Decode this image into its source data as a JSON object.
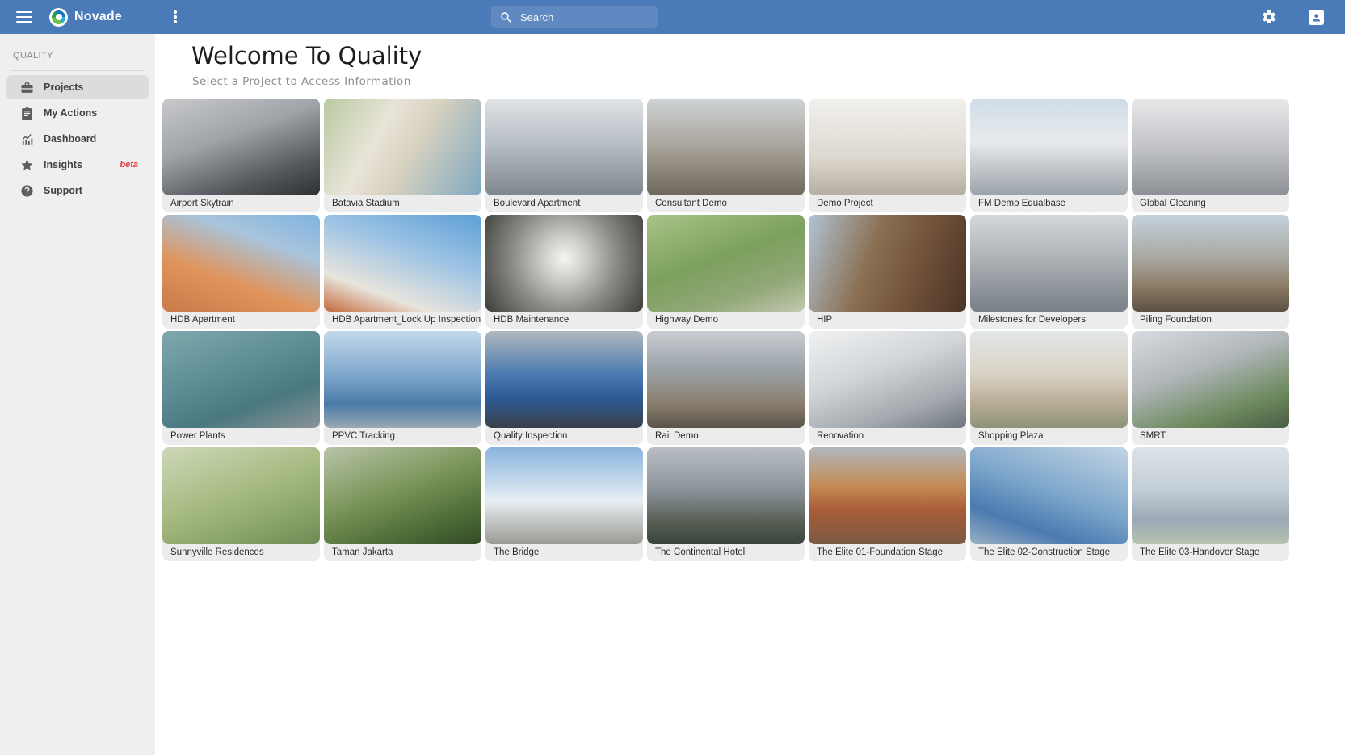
{
  "header": {
    "app_name": "Novade",
    "search_placeholder": "Search"
  },
  "sidebar": {
    "section_label": "QUALITY",
    "items": [
      {
        "label": "Projects",
        "icon": "briefcase",
        "active": true
      },
      {
        "label": "My Actions",
        "icon": "clipboard",
        "active": false
      },
      {
        "label": "Dashboard",
        "icon": "chart",
        "active": false
      },
      {
        "label": "Insights",
        "icon": "star",
        "active": false,
        "badge": "beta"
      },
      {
        "label": "Support",
        "icon": "help",
        "active": false
      }
    ]
  },
  "main": {
    "title": "Welcome To Quality",
    "subtitle": "Select a Project to Access Information",
    "projects": [
      {
        "name": "Airport Skytrain",
        "thumb": "linear-gradient(160deg,#c8c9cb 0%,#9fa3a8 40%,#55585c 75%,#2e3134 100%)"
      },
      {
        "name": "Batavia Stadium",
        "thumb": "linear-gradient(120deg,#b8c9a0 0%,#e8e4d8 35%,#d8d2c0 55%,#7fa8c0 100%)"
      },
      {
        "name": "Boulevard Apartment",
        "thumb": "linear-gradient(180deg,#dfe3e6 0%,#b9c0c6 45%,#7d858d 100%)"
      },
      {
        "name": "Consultant Demo",
        "thumb": "linear-gradient(180deg,#cfd3d6 0%,#a8a39a 50%,#6e675e 100%)"
      },
      {
        "name": "Demo Project",
        "thumb": "linear-gradient(180deg,#f2f1ee 0%,#ddd8d0 60%,#b5ad9f 100%)"
      },
      {
        "name": "FM Demo Equalbase",
        "thumb": "linear-gradient(180deg,#cfdce8 0%,#e8eaec 45%,#9aa2a8 100%)"
      },
      {
        "name": "Global Cleaning",
        "thumb": "linear-gradient(180deg,#e8e8ea 0%,#c2c4c8 50%,#8d9094 100%)"
      },
      {
        "name": "HDB Apartment",
        "thumb": "linear-gradient(200deg,#7fb3e0 0%,#a8c4dc 30%,#e0945c 65%,#c97a48 100%)"
      },
      {
        "name": "HDB Apartment_Lock Up Inspection",
        "thumb": "linear-gradient(200deg,#5d9fd6 0%,#9ec4e4 40%,#e8e4dc 75%,#c46a3c 100%)"
      },
      {
        "name": "HDB Maintenance",
        "thumb": "radial-gradient(circle at 50% 45%,#f5f5f2 0%,#c9c9c4 25%,#8a8a86 55%,#3c3c3a 100%)"
      },
      {
        "name": "Highway Demo",
        "thumb": "linear-gradient(160deg,#a8c488 0%,#7ba05e 45%,#93a878 75%,#c2c8b0 100%)"
      },
      {
        "name": "HIP",
        "thumb": "linear-gradient(110deg,#b0c4d4 0%,#8a6f52 40%,#6e4f38 70%,#4a3426 100%)"
      },
      {
        "name": "Milestones for Developers",
        "thumb": "linear-gradient(180deg,#d4d8da 0%,#a8aeb2 50%,#787f85 100%)"
      },
      {
        "name": "Piling Foundation",
        "thumb": "linear-gradient(180deg,#c4d2dc 0%,#a8a8a0 45%,#8a7a64 75%,#5c5044 100%)"
      },
      {
        "name": "Power Plants",
        "thumb": "linear-gradient(160deg,#7fa8ad 0%,#5f8e96 40%,#4a7880 70%,#8a9498 100%)"
      },
      {
        "name": "PPVC Tracking",
        "thumb": "linear-gradient(180deg,#c2d8ea 0%,#7fa8cc 45%,#4a7aa8 75%,#9aa8b4 100%)"
      },
      {
        "name": "Quality Inspection",
        "thumb": "linear-gradient(180deg,#b0b8bd 0%,#4a7ab0 45%,#2c5a94 70%,#3a4048 100%)"
      },
      {
        "name": "Rail Demo",
        "thumb": "linear-gradient(180deg,#c8ccd0 0%,#9aa2a8 40%,#8a7f6e 75%,#5a5248 100%)"
      },
      {
        "name": "Renovation",
        "thumb": "linear-gradient(160deg,#f0f1f2 0%,#d2d6d9 40%,#a2a8ad 75%,#6e757b 100%)"
      },
      {
        "name": "Shopping Plaza",
        "thumb": "linear-gradient(180deg,#e2e6e8 0%,#d8d2c4 45%,#b8ab94 75%,#8a9478 100%)"
      },
      {
        "name": "SMRT",
        "thumb": "linear-gradient(160deg,#d8dce0 0%,#b0b6ba 40%,#6e8a5e 75%,#4a5c44 100%)"
      },
      {
        "name": "Sunnyville Residences",
        "thumb": "linear-gradient(160deg,#cdd8b8 0%,#a8bc84 45%,#8aa468 75%,#6e8a54 100%)"
      },
      {
        "name": "Taman Jakarta",
        "thumb": "linear-gradient(160deg,#b8c4a8 0%,#7a9458 45%,#4e6e38 75%,#324a26 100%)"
      },
      {
        "name": "The Bridge",
        "thumb": "linear-gradient(180deg,#8ab4dc 0%,#c2d8ec 35%,#e8eef2 55%,#9a9a94 100%)"
      },
      {
        "name": "The Continental Hotel",
        "thumb": "linear-gradient(180deg,#b8bec4 0%,#8a9298 45%,#5a6258 75%,#3a443a 100%)"
      },
      {
        "name": "The Elite 01-Foundation Stage",
        "thumb": "linear-gradient(180deg,#b0b8bd 0%,#c48a54 40%,#a85c38 65%,#7a5a44 100%)"
      },
      {
        "name": "The Elite 02-Construction Stage",
        "thumb": "linear-gradient(200deg,#c2d4e4 0%,#7fa8cc 45%,#4a7ab0 75%,#9ab0c4 100%)"
      },
      {
        "name": "The Elite 03-Handover Stage",
        "thumb": "linear-gradient(180deg,#dce4ea 0%,#c2ccd4 45%,#9aa8b4 75%,#b8c4b0 100%)"
      }
    ]
  },
  "colors": {
    "header_bg": "#4a7ab7",
    "header_search_bg": "#6089c1",
    "sidebar_bg": "#efefef",
    "sidebar_active_bg": "#dcdcdc",
    "beta_badge": "#e5383b",
    "card_bg": "#ececec",
    "title_text": "#1c1c1c",
    "subtitle_text": "#8f8f8f"
  }
}
